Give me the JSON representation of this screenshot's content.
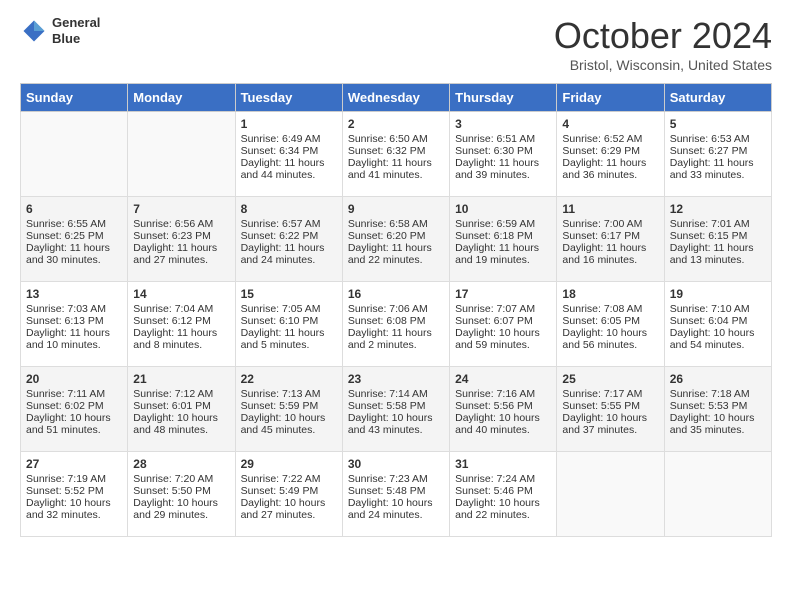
{
  "header": {
    "logo_line1": "General",
    "logo_line2": "Blue",
    "month": "October 2024",
    "location": "Bristol, Wisconsin, United States"
  },
  "days_of_week": [
    "Sunday",
    "Monday",
    "Tuesday",
    "Wednesday",
    "Thursday",
    "Friday",
    "Saturday"
  ],
  "weeks": [
    [
      {
        "num": "",
        "sunrise": "",
        "sunset": "",
        "daylight": ""
      },
      {
        "num": "",
        "sunrise": "",
        "sunset": "",
        "daylight": ""
      },
      {
        "num": "1",
        "sunrise": "Sunrise: 6:49 AM",
        "sunset": "Sunset: 6:34 PM",
        "daylight": "Daylight: 11 hours and 44 minutes."
      },
      {
        "num": "2",
        "sunrise": "Sunrise: 6:50 AM",
        "sunset": "Sunset: 6:32 PM",
        "daylight": "Daylight: 11 hours and 41 minutes."
      },
      {
        "num": "3",
        "sunrise": "Sunrise: 6:51 AM",
        "sunset": "Sunset: 6:30 PM",
        "daylight": "Daylight: 11 hours and 39 minutes."
      },
      {
        "num": "4",
        "sunrise": "Sunrise: 6:52 AM",
        "sunset": "Sunset: 6:29 PM",
        "daylight": "Daylight: 11 hours and 36 minutes."
      },
      {
        "num": "5",
        "sunrise": "Sunrise: 6:53 AM",
        "sunset": "Sunset: 6:27 PM",
        "daylight": "Daylight: 11 hours and 33 minutes."
      }
    ],
    [
      {
        "num": "6",
        "sunrise": "Sunrise: 6:55 AM",
        "sunset": "Sunset: 6:25 PM",
        "daylight": "Daylight: 11 hours and 30 minutes."
      },
      {
        "num": "7",
        "sunrise": "Sunrise: 6:56 AM",
        "sunset": "Sunset: 6:23 PM",
        "daylight": "Daylight: 11 hours and 27 minutes."
      },
      {
        "num": "8",
        "sunrise": "Sunrise: 6:57 AM",
        "sunset": "Sunset: 6:22 PM",
        "daylight": "Daylight: 11 hours and 24 minutes."
      },
      {
        "num": "9",
        "sunrise": "Sunrise: 6:58 AM",
        "sunset": "Sunset: 6:20 PM",
        "daylight": "Daylight: 11 hours and 22 minutes."
      },
      {
        "num": "10",
        "sunrise": "Sunrise: 6:59 AM",
        "sunset": "Sunset: 6:18 PM",
        "daylight": "Daylight: 11 hours and 19 minutes."
      },
      {
        "num": "11",
        "sunrise": "Sunrise: 7:00 AM",
        "sunset": "Sunset: 6:17 PM",
        "daylight": "Daylight: 11 hours and 16 minutes."
      },
      {
        "num": "12",
        "sunrise": "Sunrise: 7:01 AM",
        "sunset": "Sunset: 6:15 PM",
        "daylight": "Daylight: 11 hours and 13 minutes."
      }
    ],
    [
      {
        "num": "13",
        "sunrise": "Sunrise: 7:03 AM",
        "sunset": "Sunset: 6:13 PM",
        "daylight": "Daylight: 11 hours and 10 minutes."
      },
      {
        "num": "14",
        "sunrise": "Sunrise: 7:04 AM",
        "sunset": "Sunset: 6:12 PM",
        "daylight": "Daylight: 11 hours and 8 minutes."
      },
      {
        "num": "15",
        "sunrise": "Sunrise: 7:05 AM",
        "sunset": "Sunset: 6:10 PM",
        "daylight": "Daylight: 11 hours and 5 minutes."
      },
      {
        "num": "16",
        "sunrise": "Sunrise: 7:06 AM",
        "sunset": "Sunset: 6:08 PM",
        "daylight": "Daylight: 11 hours and 2 minutes."
      },
      {
        "num": "17",
        "sunrise": "Sunrise: 7:07 AM",
        "sunset": "Sunset: 6:07 PM",
        "daylight": "Daylight: 10 hours and 59 minutes."
      },
      {
        "num": "18",
        "sunrise": "Sunrise: 7:08 AM",
        "sunset": "Sunset: 6:05 PM",
        "daylight": "Daylight: 10 hours and 56 minutes."
      },
      {
        "num": "19",
        "sunrise": "Sunrise: 7:10 AM",
        "sunset": "Sunset: 6:04 PM",
        "daylight": "Daylight: 10 hours and 54 minutes."
      }
    ],
    [
      {
        "num": "20",
        "sunrise": "Sunrise: 7:11 AM",
        "sunset": "Sunset: 6:02 PM",
        "daylight": "Daylight: 10 hours and 51 minutes."
      },
      {
        "num": "21",
        "sunrise": "Sunrise: 7:12 AM",
        "sunset": "Sunset: 6:01 PM",
        "daylight": "Daylight: 10 hours and 48 minutes."
      },
      {
        "num": "22",
        "sunrise": "Sunrise: 7:13 AM",
        "sunset": "Sunset: 5:59 PM",
        "daylight": "Daylight: 10 hours and 45 minutes."
      },
      {
        "num": "23",
        "sunrise": "Sunrise: 7:14 AM",
        "sunset": "Sunset: 5:58 PM",
        "daylight": "Daylight: 10 hours and 43 minutes."
      },
      {
        "num": "24",
        "sunrise": "Sunrise: 7:16 AM",
        "sunset": "Sunset: 5:56 PM",
        "daylight": "Daylight: 10 hours and 40 minutes."
      },
      {
        "num": "25",
        "sunrise": "Sunrise: 7:17 AM",
        "sunset": "Sunset: 5:55 PM",
        "daylight": "Daylight: 10 hours and 37 minutes."
      },
      {
        "num": "26",
        "sunrise": "Sunrise: 7:18 AM",
        "sunset": "Sunset: 5:53 PM",
        "daylight": "Daylight: 10 hours and 35 minutes."
      }
    ],
    [
      {
        "num": "27",
        "sunrise": "Sunrise: 7:19 AM",
        "sunset": "Sunset: 5:52 PM",
        "daylight": "Daylight: 10 hours and 32 minutes."
      },
      {
        "num": "28",
        "sunrise": "Sunrise: 7:20 AM",
        "sunset": "Sunset: 5:50 PM",
        "daylight": "Daylight: 10 hours and 29 minutes."
      },
      {
        "num": "29",
        "sunrise": "Sunrise: 7:22 AM",
        "sunset": "Sunset: 5:49 PM",
        "daylight": "Daylight: 10 hours and 27 minutes."
      },
      {
        "num": "30",
        "sunrise": "Sunrise: 7:23 AM",
        "sunset": "Sunset: 5:48 PM",
        "daylight": "Daylight: 10 hours and 24 minutes."
      },
      {
        "num": "31",
        "sunrise": "Sunrise: 7:24 AM",
        "sunset": "Sunset: 5:46 PM",
        "daylight": "Daylight: 10 hours and 22 minutes."
      },
      {
        "num": "",
        "sunrise": "",
        "sunset": "",
        "daylight": ""
      },
      {
        "num": "",
        "sunrise": "",
        "sunset": "",
        "daylight": ""
      }
    ]
  ]
}
